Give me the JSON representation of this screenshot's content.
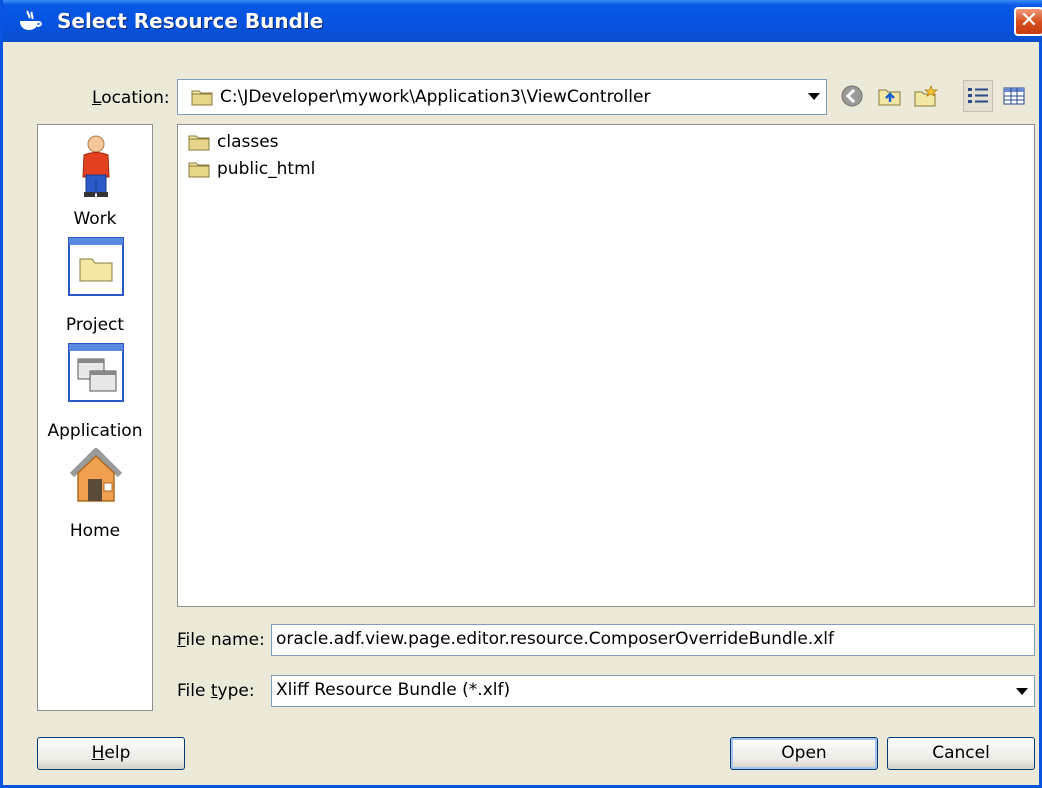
{
  "window": {
    "title": "Select Resource Bundle",
    "close_glyph": "✕"
  },
  "location": {
    "label_prefix": "L",
    "label_rest": "ocation:",
    "path": "C:\\JDeveloper\\mywork\\Application3\\ViewController"
  },
  "toolbar": {
    "icons": [
      "back-icon",
      "up-folder-icon",
      "new-folder-icon",
      "list-view-icon",
      "details-view-icon"
    ]
  },
  "places": [
    {
      "label": "Work",
      "icon": "work-person-icon"
    },
    {
      "label": "Project",
      "icon": "project-folder-icon"
    },
    {
      "label": "Application",
      "icon": "application-windows-icon"
    },
    {
      "label": "Home",
      "icon": "home-icon"
    }
  ],
  "files": [
    {
      "name": "classes",
      "icon": "folder-icon"
    },
    {
      "name": "public_html",
      "icon": "folder-icon"
    }
  ],
  "file_name": {
    "label_prefix": "F",
    "label_rest": "ile name:",
    "value": "oracle.adf.view.page.editor.resource.ComposerOverrideBundle.xlf"
  },
  "file_type": {
    "label_start": "File ",
    "label_u": "t",
    "label_rest": "ype:",
    "value": "Xliff Resource Bundle (*.xlf)"
  },
  "buttons": {
    "help_u": "H",
    "help_rest": "elp",
    "open": "Open",
    "cancel": "Cancel"
  },
  "colors": {
    "title_bar": "#0553e0",
    "dialog_bg": "#ece9d8",
    "close": "#d9501f"
  }
}
